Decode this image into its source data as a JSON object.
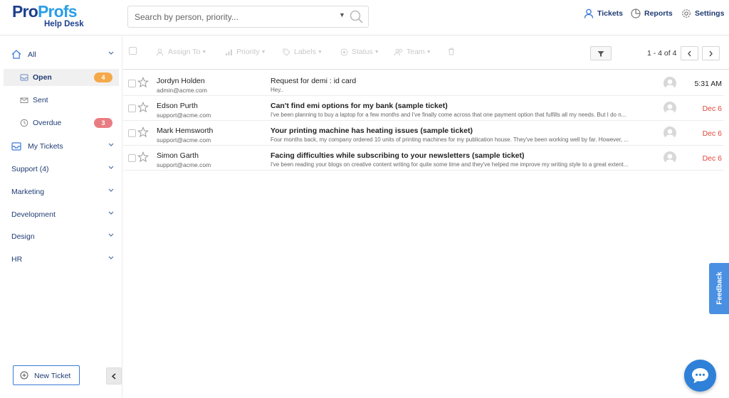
{
  "logo": {
    "brand_pro": "Pro",
    "brand_profs": "Profs",
    "subtitle": "Help Desk"
  },
  "search": {
    "placeholder": "Search by person, priority..."
  },
  "topnav": {
    "tickets": "Tickets",
    "reports": "Reports",
    "settings": "Settings"
  },
  "sidebar": {
    "all": "All",
    "open": {
      "label": "Open",
      "count": "4"
    },
    "sent": "Sent",
    "overdue": {
      "label": "Overdue",
      "count": "3"
    },
    "my_tickets": "My Tickets",
    "groups": [
      "Support (4)",
      "Marketing",
      "Development",
      "Design",
      "HR"
    ],
    "new_ticket": "New Ticket"
  },
  "toolbar": {
    "assign_to": "Assign To",
    "priority": "Priority",
    "labels": "Labels",
    "status": "Status",
    "team": "Team",
    "pagination": "1 - 4 of 4"
  },
  "tickets": [
    {
      "name": "Jordyn Holden",
      "email": "admin@acme.com",
      "subject": "Request for demi : id card",
      "preview": "Hey..",
      "time": "5:31 AM",
      "overdue": false
    },
    {
      "name": "Edson Purth",
      "email": "support@acme.com",
      "subject": "Can't find emi options for my bank (sample ticket)",
      "preview": "I've been planning to buy a laptop for a few months and I've finally come across that one payment option that fulfills all my needs. But I do n...",
      "time": "Dec 6",
      "overdue": true
    },
    {
      "name": "Mark Hemsworth",
      "email": "support@acme.com",
      "subject": "Your printing machine has heating issues (sample ticket)",
      "preview": "Four months back, my company ordered 10 units of printing machines for my publication house. They've been working well by far. However, ...",
      "time": "Dec 6",
      "overdue": true
    },
    {
      "name": "Simon Garth",
      "email": "support@acme.com",
      "subject": "Facing difficulties while subscribing to your newsletters (sample ticket)",
      "preview": "I've been reading your blogs on creative content writing for quite some time and they've helped me improve my writing style to a great extent...",
      "time": "Dec 6",
      "overdue": true
    }
  ],
  "feedback": "Feedback",
  "colors": {
    "brand_dark": "#1d3f8c",
    "brand_light": "#2a9ee8",
    "open_badge": "#f5a94a",
    "overdue_badge": "#e97c82",
    "overdue_text": "#e0453a",
    "feedback": "#4a90e2"
  }
}
